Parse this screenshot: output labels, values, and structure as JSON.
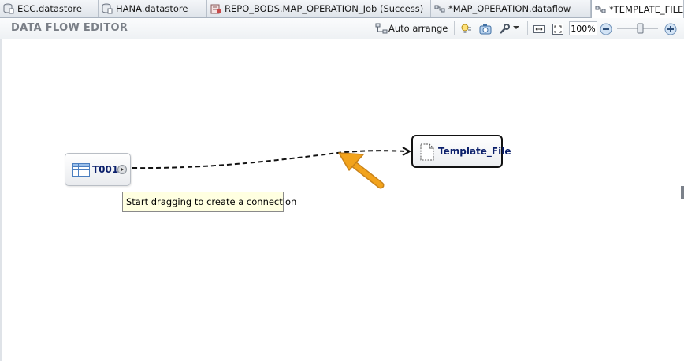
{
  "tabs": [
    {
      "label": "ECC.datastore",
      "icon": "datastore-icon",
      "active": false
    },
    {
      "label": "HANA.datastore",
      "icon": "datastore-icon",
      "active": false
    },
    {
      "label": "REPO_BODS.MAP_OPERATION_Job (Success)",
      "icon": "job-icon",
      "active": false
    },
    {
      "label": "*MAP_OPERATION.dataflow",
      "icon": "dataflow-icon",
      "active": false
    },
    {
      "label": "*TEMPLATE_FILE",
      "icon": "dataflow-icon",
      "active": true
    }
  ],
  "editor": {
    "title": "DATA FLOW EDITOR",
    "auto_arrange_label": "Auto arrange",
    "zoom_level": "100%"
  },
  "canvas": {
    "source_node": {
      "name": "T001",
      "icon": "table-icon"
    },
    "target_node": {
      "name": "Template_File",
      "icon": "file-icon"
    },
    "tooltip": "Start dragging to create a connection"
  },
  "colors": {
    "arrow": "#f2a31c",
    "node_text": "#0b1f6b",
    "tooltip_bg": "#ffffe1"
  }
}
